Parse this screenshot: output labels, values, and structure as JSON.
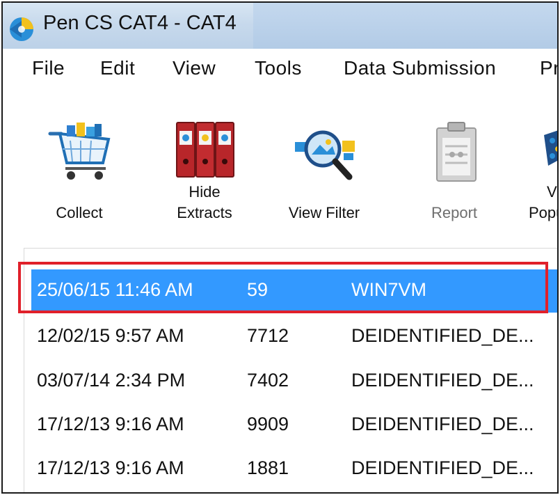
{
  "window": {
    "title": "Pen CS CAT4 - CAT4",
    "logo_icon": "pen-cs-logo-icon"
  },
  "menu": [
    {
      "label": "File"
    },
    {
      "label": "Edit"
    },
    {
      "label": "View"
    },
    {
      "label": "Tools"
    },
    {
      "label": "Data Submission"
    },
    {
      "label": "Pr"
    }
  ],
  "toolbar": {
    "collect": {
      "label": "Collect",
      "icon": "shopping-cart-icon"
    },
    "hide_extracts": {
      "label_line1": "Hide",
      "label_line2": "Extracts",
      "icon": "binders-icon"
    },
    "view_filter": {
      "label": "View Filter",
      "icon": "magnifier-icon"
    },
    "report": {
      "label": "Report",
      "icon": "clipboard-icon",
      "disabled": true
    },
    "view_population": {
      "label_line1": "Vi",
      "label_line2": "Popu",
      "icon": "population-icon"
    }
  },
  "extracts": [
    {
      "date": "25/06/15 11:46 AM",
      "count": "59",
      "name": "WIN7VM",
      "selected": true
    },
    {
      "date": "12/02/15 9:57 AM",
      "count": "7712",
      "name": "DEIDENTIFIED_DE..."
    },
    {
      "date": "03/07/14 2:34 PM",
      "count": "7402",
      "name": "DEIDENTIFIED_DE..."
    },
    {
      "date": "17/12/13 9:16 AM",
      "count": "9909",
      "name": "DEIDENTIFIED_DE..."
    },
    {
      "date": "17/12/13 9:16 AM",
      "count": "1881",
      "name": "DEIDENTIFIED_DE..."
    }
  ],
  "colors": {
    "selection": "#3399ff",
    "highlight_border": "#e0202a"
  }
}
